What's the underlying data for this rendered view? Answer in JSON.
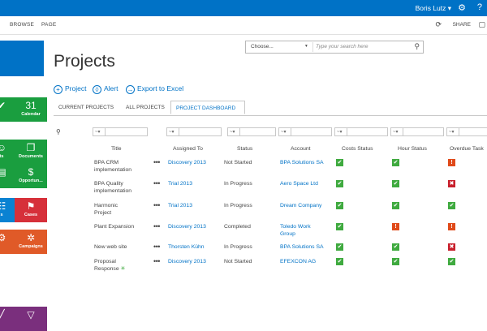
{
  "topbar": {
    "user": "Boris Lutz ▾",
    "gear_icon": "gear-icon",
    "help": "?"
  },
  "ribbon": {
    "browse": "BROWSE",
    "page": "PAGE",
    "share": "SHARE"
  },
  "page": {
    "title": "Projects"
  },
  "search": {
    "scope": "Choose...",
    "caret": "▾",
    "placeholder": "Type your search here"
  },
  "actions": {
    "project": "Project",
    "alert": "Alert",
    "export": "Export to Excel"
  },
  "tabs": [
    "CURRENT PROJECTS",
    "ALL PROJECTS",
    "PROJECT DASHBOARD"
  ],
  "active_tab": "PROJECT DASHBOARD",
  "filter": {
    "symbol": "~",
    "caret": "▾"
  },
  "tiles": [
    {
      "label": "",
      "icon": "✔",
      "color": "#1a9e3f"
    },
    {
      "label": "Calendar",
      "icon": "31",
      "color": "#1a9e3f"
    },
    {
      "label": "ts",
      "icon": "☺",
      "color": "#1a9e3f"
    },
    {
      "label": "Documents",
      "icon": "❐",
      "color": "#1a9e3f"
    },
    {
      "label": "",
      "icon": "▤",
      "color": "#1a9e3f"
    },
    {
      "label": "Opportun...",
      "icon": "$",
      "color": "#1a9e3f"
    },
    {
      "label": "s",
      "icon": "☷",
      "color": "#0a82d2"
    },
    {
      "label": "Cases",
      "icon": "⚑",
      "color": "#d6303a"
    },
    {
      "label": "",
      "icon": "⚙",
      "color": "#e05a28"
    },
    {
      "label": "Campaigns",
      "icon": "✲",
      "color": "#e05a28"
    },
    {
      "label": "",
      "icon": "╱",
      "color": "#7a2f7d"
    },
    {
      "label": "",
      "icon": "▽",
      "color": "#7a2f7d"
    }
  ],
  "table": {
    "headers": [
      "Title",
      "Assigned To",
      "Status",
      "Account",
      "Costs Status",
      "Hour Status",
      "Overdue Task"
    ],
    "rows": [
      {
        "title": [
          "BPA CRM",
          "implementation"
        ],
        "assigned": "Discovery 2013",
        "status": "Not Started",
        "account": [
          "BPA Solutions SA"
        ],
        "costs": "ok",
        "hour": "ok",
        "overdue": "warn",
        "title_new": false
      },
      {
        "title": [
          "BPA Quality",
          "implementation"
        ],
        "assigned": "Trial 2013",
        "status": "In Progress",
        "account": [
          "Aero Space Ltd"
        ],
        "costs": "ok",
        "hour": "ok",
        "overdue": "err",
        "title_new": false
      },
      {
        "title": [
          "Harmonic",
          "Project"
        ],
        "assigned": "Trial 2013",
        "status": "In Progress",
        "account": [
          "Dream Company"
        ],
        "costs": "ok",
        "hour": "ok",
        "overdue": "ok",
        "title_new": false
      },
      {
        "title": [
          "Plant Expansion"
        ],
        "assigned": "Discovery 2013",
        "status": "Completed",
        "account": [
          "Toledo Work",
          "Group"
        ],
        "costs": "ok",
        "hour": "warn",
        "overdue": "warn",
        "title_new": false
      },
      {
        "title": [
          "New web site"
        ],
        "assigned": "Thorsten Kühn",
        "status": "In Progress",
        "account": [
          "BPA Solutions SA"
        ],
        "costs": "ok",
        "hour": "ok",
        "overdue": "err",
        "title_new": false
      },
      {
        "title": [
          "Proposal",
          "Response"
        ],
        "assigned": "Discovery 2013",
        "status": "Not Started",
        "account": [
          "EFEXCON AG"
        ],
        "costs": "ok",
        "hour": "ok",
        "overdue": "ok",
        "title_new": true
      }
    ],
    "row_menu": "•••",
    "new_marker": "✳"
  },
  "status_colors": {
    "ok": "#3faa3f",
    "warn": "#e04a1a",
    "err": "#c8202c"
  },
  "status_glyphs": {
    "ok": "✔",
    "warn": "!",
    "err": "✖"
  }
}
